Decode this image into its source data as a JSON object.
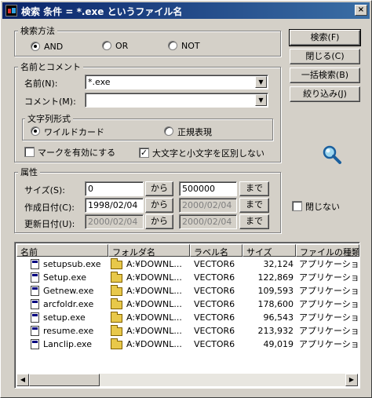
{
  "window": {
    "title": "検索 条件 = *.exe というファイル名",
    "close_glyph": "×"
  },
  "search_method": {
    "legend": "検索方法",
    "options": [
      {
        "label": "AND",
        "selected": true
      },
      {
        "label": "OR",
        "selected": false
      },
      {
        "label": "NOT",
        "selected": false
      }
    ]
  },
  "name_comment": {
    "legend": "名前とコメント",
    "name_label": "名前(N):",
    "name_value": "*.exe",
    "comment_label": "コメント(M):",
    "comment_value": ""
  },
  "string_format": {
    "legend": "文字列形式",
    "wildcard_label": "ワイルドカード",
    "regex_label": "正規表現",
    "selected": "wildcard"
  },
  "options": {
    "mark_enable_label": "マークを有効にする",
    "mark_enable_checked": false,
    "case_sensitive_label": "大文字と小文字を区別しない",
    "case_sensitive_checked": true
  },
  "attributes": {
    "legend": "属性",
    "range_from": "から",
    "range_to": "まで",
    "size_label": "サイズ(S):",
    "size_from": "0",
    "size_to": "500000",
    "created_label": "作成日付(C):",
    "created_from": "1998/02/04",
    "created_to": "2000/02/04",
    "updated_label": "更新日付(U):",
    "updated_from": "2000/02/04",
    "updated_to": "2000/02/04"
  },
  "buttons": {
    "search": "検索(F)",
    "close": "閉じる(C)",
    "batch_search": "一括検索(B)",
    "narrow": "絞り込み(J)",
    "keep_open_label": "閉じない",
    "keep_open_checked": false
  },
  "results": {
    "columns": [
      "名前",
      "フォルダ名",
      "ラベル名",
      "サイズ",
      "ファイルの種類"
    ],
    "rows": [
      {
        "name": "setupsub.exe",
        "folder": "A:¥DOWNL...",
        "label": "VECTOR6",
        "size": "32,124",
        "type": "アプリケーション"
      },
      {
        "name": "Setup.exe",
        "folder": "A:¥DOWNL...",
        "label": "VECTOR6",
        "size": "122,869",
        "type": "アプリケーション"
      },
      {
        "name": "Getnew.exe",
        "folder": "A:¥DOWNL...",
        "label": "VECTOR6",
        "size": "109,593",
        "type": "アプリケーション"
      },
      {
        "name": "arcfoldr.exe",
        "folder": "A:¥DOWNL...",
        "label": "VECTOR6",
        "size": "178,600",
        "type": "アプリケーション"
      },
      {
        "name": "setup.exe",
        "folder": "A:¥DOWNL...",
        "label": "VECTOR6",
        "size": "96,543",
        "type": "アプリケーション"
      },
      {
        "name": "resume.exe",
        "folder": "A:¥DOWNL...",
        "label": "VECTOR6",
        "size": "213,932",
        "type": "アプリケーション"
      },
      {
        "name": "Lanclip.exe",
        "folder": "A:¥DOWNL...",
        "label": "VECTOR6",
        "size": "49,019",
        "type": "アプリケーション"
      }
    ]
  },
  "icons": {
    "app": "app-icon",
    "search": "magnifier-icon",
    "file": "exe-file-icon",
    "folder": "folder-icon",
    "scroll_left": "◀",
    "scroll_right": "▶",
    "dropdown": "▼"
  },
  "colors": {
    "titlebar_start": "#0a246a",
    "titlebar_end": "#3a6ea5",
    "face": "#d4d0c8"
  }
}
